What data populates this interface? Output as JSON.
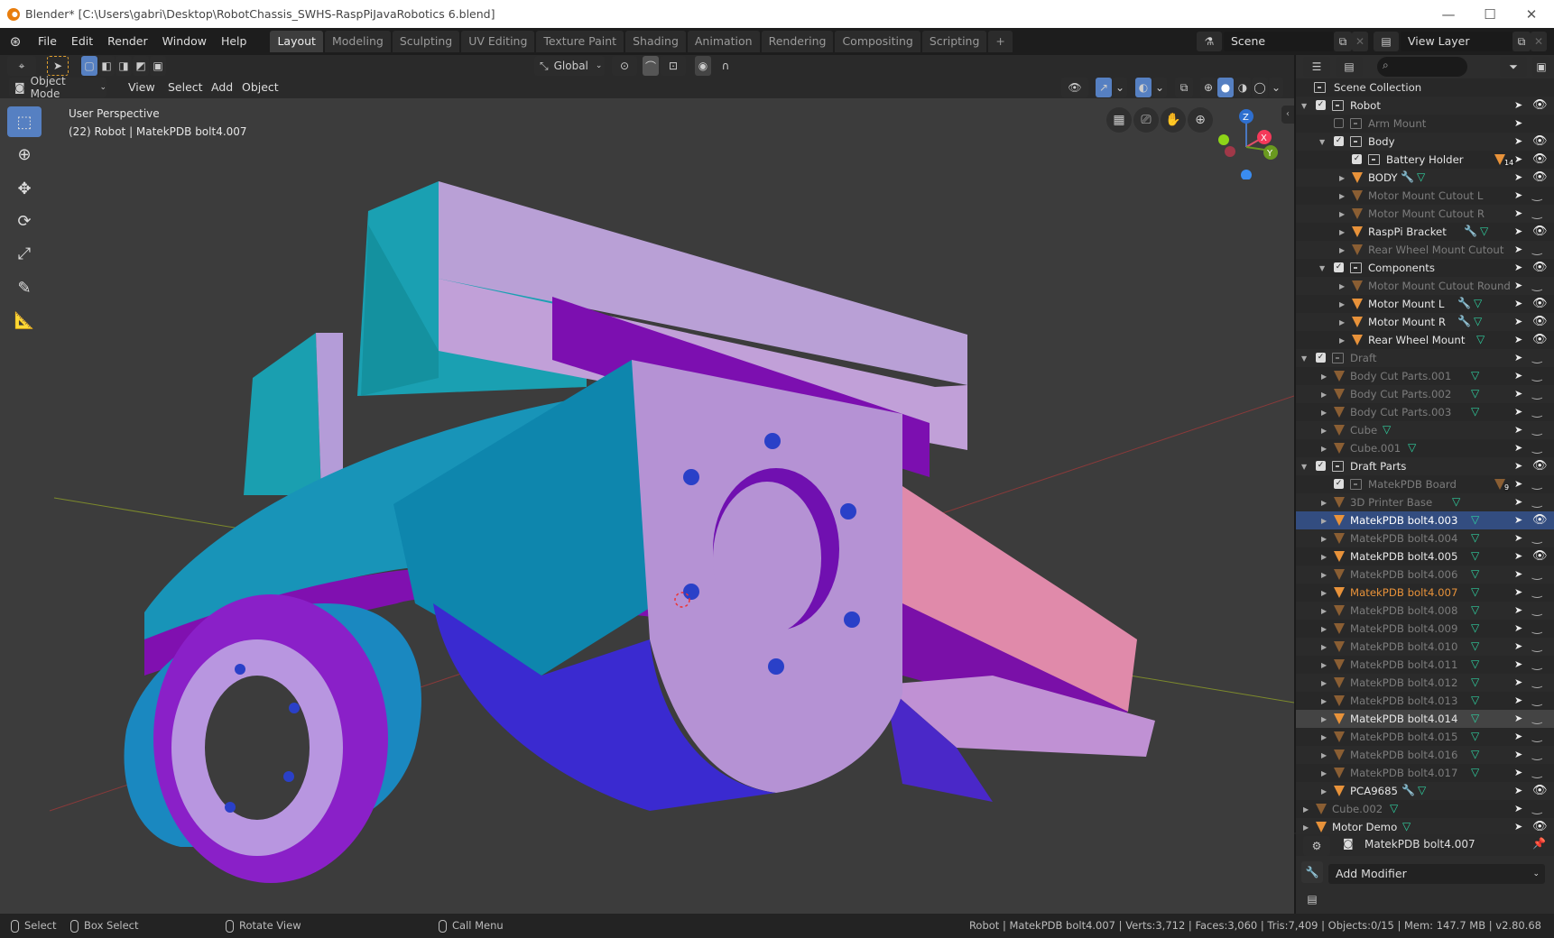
{
  "window": {
    "title": "Blender* [C:\\Users\\gabri\\Desktop\\RobotChassis_SWHS-RaspPiJavaRobotics 6.blend]",
    "controls": {
      "minimize": "—",
      "maximize": "☐",
      "close": "✕"
    }
  },
  "menu": {
    "items": [
      "File",
      "Edit",
      "Render",
      "Window",
      "Help"
    ]
  },
  "workspaces": {
    "tabs": [
      "Layout",
      "Modeling",
      "Sculpting",
      "UV Editing",
      "Texture Paint",
      "Shading",
      "Animation",
      "Rendering",
      "Compositing",
      "Scripting"
    ],
    "active": "Layout",
    "add": "+"
  },
  "scene": {
    "label": "Scene",
    "view_layer": "View Layer"
  },
  "tool_header": {
    "orientation": "Global"
  },
  "viewport_header": {
    "mode": "Object Mode",
    "menus": [
      "View",
      "Select",
      "Add",
      "Object"
    ]
  },
  "viewport": {
    "perspective": "User Perspective",
    "info": "(22) Robot | MatekPDB bolt4.007",
    "gizmo": {
      "x": "X",
      "y": "Y",
      "z": "Z"
    },
    "colors": {
      "x": "#f5395a",
      "y": "#6a9a1f",
      "z": "#2e6fcf",
      "bg": "#3c3c3c"
    }
  },
  "toolbar": {
    "tools": [
      "select-box",
      "cursor",
      "move",
      "rotate",
      "scale",
      "annotate",
      "measure"
    ],
    "active": "select-box"
  },
  "outliner": {
    "search_placeholder": "",
    "root": "Scene Collection",
    "rows": [
      {
        "label": "Robot",
        "type": "collection",
        "depth": 0,
        "checked": true,
        "expanded": true,
        "visible": true,
        "state": "bright"
      },
      {
        "label": "Arm Mount",
        "type": "collection",
        "depth": 1,
        "checked": false,
        "visible": null,
        "state": "dim"
      },
      {
        "label": "Body",
        "type": "collection",
        "depth": 1,
        "checked": true,
        "expanded": true,
        "visible": true,
        "state": "bright"
      },
      {
        "label": "Battery Holder",
        "type": "collection",
        "depth": 2,
        "checked": true,
        "visible": true,
        "state": "bright",
        "badge": "14"
      },
      {
        "label": "BODY",
        "type": "object",
        "depth": 2,
        "modifier": true,
        "mesh": true,
        "visible": true,
        "state": "bright"
      },
      {
        "label": "Motor Mount Cutout L",
        "type": "object",
        "depth": 2,
        "visible": false,
        "state": "dim"
      },
      {
        "label": "Motor Mount Cutout R",
        "type": "object",
        "depth": 2,
        "visible": false,
        "state": "dim"
      },
      {
        "label": "RaspPi Bracket",
        "type": "object",
        "depth": 2,
        "modifier": true,
        "mesh": true,
        "visible": true,
        "state": "bright"
      },
      {
        "label": "Rear Wheel Mount Cutout",
        "type": "object",
        "depth": 2,
        "visible": false,
        "state": "dim"
      },
      {
        "label": "Components",
        "type": "collection",
        "depth": 1,
        "checked": true,
        "expanded": true,
        "visible": true,
        "state": "bright"
      },
      {
        "label": "Motor Mount Cutout Round",
        "type": "object",
        "depth": 2,
        "visible": false,
        "state": "dim"
      },
      {
        "label": "Motor Mount L",
        "type": "object",
        "depth": 2,
        "modifier": true,
        "mesh": true,
        "visible": true,
        "state": "bright"
      },
      {
        "label": "Motor Mount R",
        "type": "object",
        "depth": 2,
        "modifier": true,
        "mesh": true,
        "visible": true,
        "state": "bright"
      },
      {
        "label": "Rear Wheel Mount",
        "type": "object",
        "depth": 2,
        "mesh": true,
        "visible": true,
        "state": "bright"
      },
      {
        "label": "Draft",
        "type": "collection",
        "depth": 0,
        "checked": true,
        "expanded": true,
        "visible": false,
        "state": "dim"
      },
      {
        "label": "Body Cut Parts.001",
        "type": "object",
        "depth": 1,
        "mesh": true,
        "visible": false,
        "state": "dim"
      },
      {
        "label": "Body Cut Parts.002",
        "type": "object",
        "depth": 1,
        "mesh": true,
        "visible": false,
        "state": "dim"
      },
      {
        "label": "Body Cut Parts.003",
        "type": "object",
        "depth": 1,
        "mesh": true,
        "visible": false,
        "state": "dim"
      },
      {
        "label": "Cube",
        "type": "object",
        "depth": 1,
        "mesh": true,
        "visible": false,
        "state": "dim"
      },
      {
        "label": "Cube.001",
        "type": "object",
        "depth": 1,
        "mesh": true,
        "visible": false,
        "state": "dim"
      },
      {
        "label": "Draft Parts",
        "type": "collection",
        "depth": 0,
        "checked": true,
        "expanded": true,
        "visible": true,
        "state": "bright"
      },
      {
        "label": "MatekPDB Board",
        "type": "collection",
        "depth": 1,
        "checked": true,
        "visible": false,
        "state": "dim",
        "badge": "9"
      },
      {
        "label": "3D Printer Base",
        "type": "object",
        "depth": 1,
        "mesh": true,
        "visible": false,
        "state": "dim"
      },
      {
        "label": "MatekPDB bolt4.003",
        "type": "object",
        "depth": 1,
        "mesh": true,
        "visible": true,
        "state": "selected"
      },
      {
        "label": "MatekPDB bolt4.004",
        "type": "object",
        "depth": 1,
        "mesh": true,
        "visible": false,
        "state": "dim"
      },
      {
        "label": "MatekPDB bolt4.005",
        "type": "object",
        "depth": 1,
        "mesh": true,
        "visible": true,
        "state": "bright"
      },
      {
        "label": "MatekPDB bolt4.006",
        "type": "object",
        "depth": 1,
        "mesh": true,
        "visible": false,
        "state": "dim"
      },
      {
        "label": "MatekPDB bolt4.007",
        "type": "object",
        "depth": 1,
        "mesh": true,
        "visible": false,
        "state": "active"
      },
      {
        "label": "MatekPDB bolt4.008",
        "type": "object",
        "depth": 1,
        "mesh": true,
        "visible": false,
        "state": "dim"
      },
      {
        "label": "MatekPDB bolt4.009",
        "type": "object",
        "depth": 1,
        "mesh": true,
        "visible": false,
        "state": "dim"
      },
      {
        "label": "MatekPDB bolt4.010",
        "type": "object",
        "depth": 1,
        "mesh": true,
        "visible": false,
        "state": "dim"
      },
      {
        "label": "MatekPDB bolt4.011",
        "type": "object",
        "depth": 1,
        "mesh": true,
        "visible": false,
        "state": "dim"
      },
      {
        "label": "MatekPDB bolt4.012",
        "type": "object",
        "depth": 1,
        "mesh": true,
        "visible": false,
        "state": "dim"
      },
      {
        "label": "MatekPDB bolt4.013",
        "type": "object",
        "depth": 1,
        "mesh": true,
        "visible": false,
        "state": "dim"
      },
      {
        "label": "MatekPDB bolt4.014",
        "type": "object",
        "depth": 1,
        "mesh": true,
        "visible": false,
        "state": "hover"
      },
      {
        "label": "MatekPDB bolt4.015",
        "type": "object",
        "depth": 1,
        "mesh": true,
        "visible": false,
        "state": "dim"
      },
      {
        "label": "MatekPDB bolt4.016",
        "type": "object",
        "depth": 1,
        "mesh": true,
        "visible": false,
        "state": "dim"
      },
      {
        "label": "MatekPDB bolt4.017",
        "type": "object",
        "depth": 1,
        "mesh": true,
        "visible": false,
        "state": "dim"
      },
      {
        "label": "PCA9685",
        "type": "object",
        "depth": 1,
        "modifier": true,
        "mesh": true,
        "visible": true,
        "state": "bright"
      },
      {
        "label": "Cube.002",
        "type": "object",
        "depth": 0,
        "mesh": true,
        "visible": false,
        "state": "dim"
      },
      {
        "label": "Motor Demo",
        "type": "object",
        "depth": 0,
        "mesh": true,
        "visible": true,
        "state": "bright"
      }
    ]
  },
  "properties": {
    "object_name": "MatekPDB bolt4.007",
    "add_modifier": "Add Modifier"
  },
  "statusbar": {
    "hints": [
      {
        "label": "Select"
      },
      {
        "label": "Box Select"
      },
      {
        "label": "Rotate View"
      },
      {
        "label": "Call Menu"
      }
    ],
    "stats": "Robot | MatekPDB bolt4.007 | Verts:3,712 | Faces:3,060 | Tris:7,409 | Objects:0/15 | Mem: 147.7 MB | v2.80.68"
  }
}
